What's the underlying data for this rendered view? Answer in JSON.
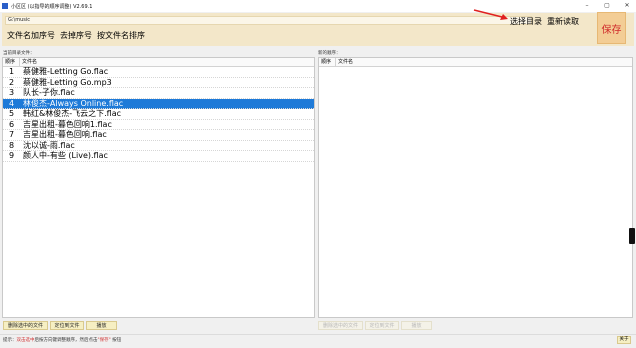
{
  "window": {
    "title": "小区区 (以指导的顺序调整) V2.69.1",
    "minimize": "–",
    "maximize": "▢",
    "close": "✕"
  },
  "top": {
    "path": "G:\\music",
    "actions_left": [
      "文件名加序号",
      "去掉序号",
      "按文件名排序"
    ],
    "actions_right": [
      "选择目录",
      "重新读取"
    ],
    "save_label": "保存"
  },
  "left_pane": {
    "label": "当前目录文件：",
    "col_index": "顺序",
    "col_name": "文件名",
    "rows": [
      {
        "idx": "1",
        "name": "蔡健雅-Letting Go.flac"
      },
      {
        "idx": "2",
        "name": "蔡健雅-Letting Go.mp3"
      },
      {
        "idx": "3",
        "name": "队长-子你.flac"
      },
      {
        "idx": "4",
        "name": "林俊杰-Always Online.flac"
      },
      {
        "idx": "5",
        "name": "韩红&林俊杰-飞云之下.flac"
      },
      {
        "idx": "6",
        "name": "吉星出租-暮色回响1.flac"
      },
      {
        "idx": "7",
        "name": "吉星出租-暮色回响.flac"
      },
      {
        "idx": "8",
        "name": "沈以诚-雨.flac"
      },
      {
        "idx": "9",
        "name": "颜人中-有些 (Live).flac"
      }
    ],
    "selected_index": 3,
    "buttons": [
      "删除选中的文件",
      "定位到文件",
      "播放"
    ]
  },
  "right_pane": {
    "label": "新的顺序：",
    "col_index": "顺序",
    "col_name": "文件名",
    "buttons": [
      "删除选中的文件",
      "定位到文件",
      "播放"
    ]
  },
  "status": {
    "prefix": "提示：",
    "highlight": "双击选中",
    "middle": "后按方向键调整顺序，然后点击",
    "highlight2": "\"保存\"",
    "suffix": " 按钮",
    "close_label": "关于"
  }
}
